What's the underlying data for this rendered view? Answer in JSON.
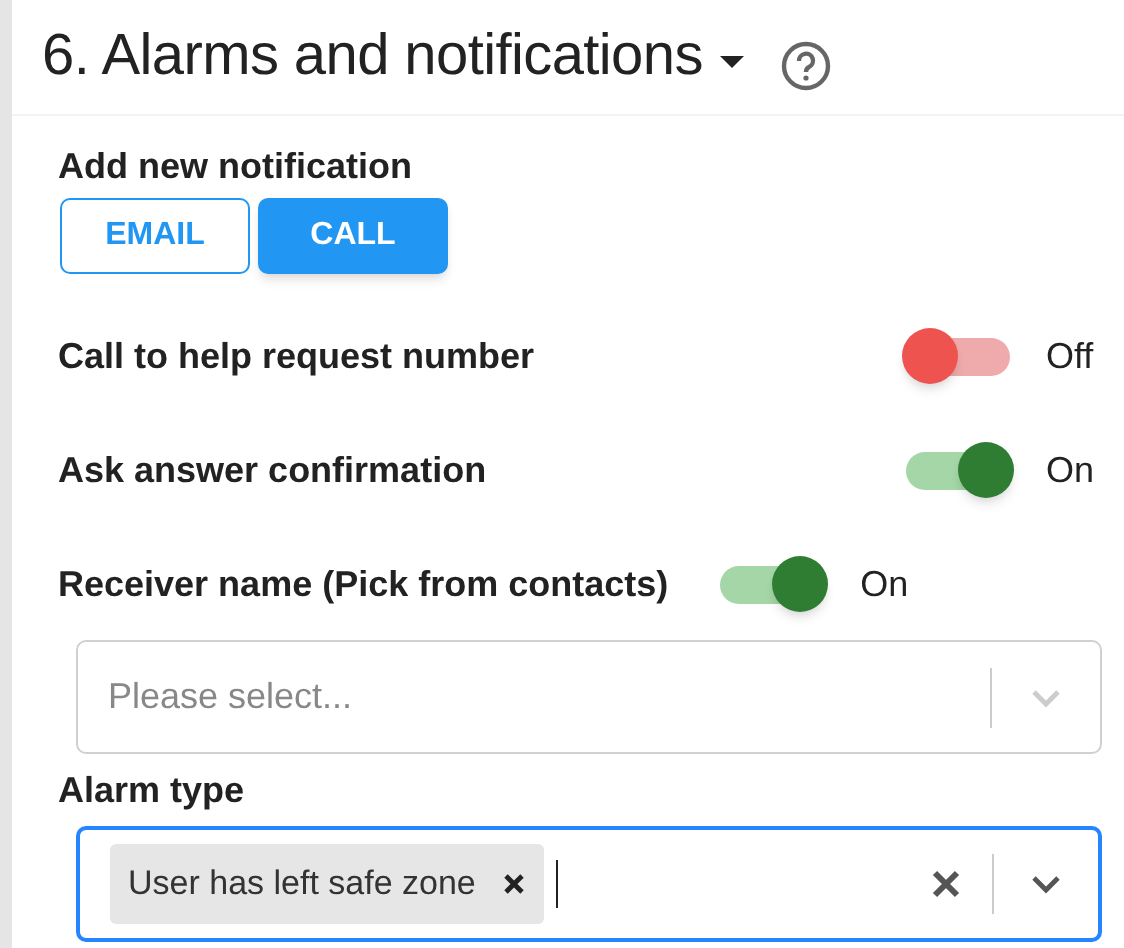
{
  "section": {
    "title": "6. Alarms and notifications",
    "expanded": true
  },
  "add_notification": {
    "label": "Add new notification",
    "buttons": [
      {
        "label": "EMAIL",
        "selected": false
      },
      {
        "label": "CALL",
        "selected": true
      }
    ]
  },
  "toggles": [
    {
      "label": "Call to help request number",
      "on": false,
      "state_text": "Off",
      "kind": "spread"
    },
    {
      "label": "Ask answer confirmation",
      "on": true,
      "state_text": "On",
      "kind": "spread"
    },
    {
      "label": "Receiver name (Pick from contacts)",
      "on": true,
      "state_text": "On",
      "kind": "inline"
    }
  ],
  "receiver_select": {
    "placeholder": "Please select..."
  },
  "alarm_type": {
    "label": "Alarm type",
    "focused": true,
    "tags": [
      "User has left safe zone"
    ]
  }
}
